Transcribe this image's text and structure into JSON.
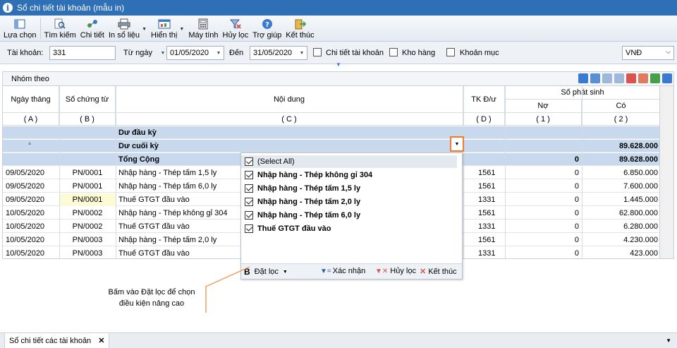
{
  "window": {
    "title": "Sổ chi tiết tài khoản (mẫu in)"
  },
  "toolbar": [
    {
      "label": "Lựa chọn",
      "icon": "select-icon"
    },
    {
      "label": "Tìm kiếm",
      "icon": "search-icon"
    },
    {
      "label": "Chi tiết",
      "icon": "detail-icon"
    },
    {
      "label": "In sổ liệu",
      "icon": "printer-icon",
      "dropdown": true
    },
    {
      "label": "Hiển thị",
      "icon": "display-icon",
      "dropdown": true
    },
    {
      "label": "Máy tính",
      "icon": "calculator-icon"
    },
    {
      "label": "Hủy lọc",
      "icon": "clear-filter-icon"
    },
    {
      "label": "Trợ giúp",
      "icon": "help-icon"
    },
    {
      "label": "Kết thúc",
      "icon": "exit-icon"
    }
  ],
  "filters": {
    "account_label": "Tài khoản:",
    "account_value": "331",
    "from_label": "Từ ngày",
    "from_value": "01/05/2020",
    "to_label": "Đến",
    "to_value": "31/05/2020",
    "detail_label": "Chi tiết tài khoản",
    "warehouse_label": "Kho hàng",
    "item_label": "Khoản mục",
    "currency": "VNĐ"
  },
  "group_bar": {
    "title": "Nhóm theo"
  },
  "grid": {
    "headers": {
      "date": "Ngày tháng",
      "doc": "Số chứng từ",
      "content": "Nội dung",
      "tk": "TK Đ/ư",
      "arising": "Số phát sinh",
      "debit": "Nợ",
      "credit": "Có"
    },
    "codes": {
      "date": "( A )",
      "doc": "( B )",
      "content": "( C )",
      "tk": "( D )",
      "debit": "( 1 )",
      "credit": "( 2 )"
    },
    "opening_label": "Dư đầu kỳ",
    "closing_label": "Dư cuối kỳ",
    "closing_credit": "89.628.000",
    "total_label": "Tổng Cộng",
    "total_debit": "0",
    "total_credit": "89.628.000",
    "rows": [
      {
        "date": "09/05/2020",
        "doc": "PN/0001",
        "content": "Nhập hàng - Thép tấm 1,5 ly",
        "tk": "1561",
        "debit": "0",
        "credit": "6.850.000"
      },
      {
        "date": "09/05/2020",
        "doc": "PN/0001",
        "content": "Nhập hàng - Thép tấm 6,0 ly",
        "tk": "1561",
        "debit": "0",
        "credit": "7.600.000"
      },
      {
        "date": "09/05/2020",
        "doc": "PN/0001",
        "content": "Thuế GTGT đầu vào",
        "tk": "1331",
        "debit": "0",
        "credit": "1.445.000"
      },
      {
        "date": "10/05/2020",
        "doc": "PN/0002",
        "content": "Nhập hàng - Thép không gỉ 304",
        "tk": "1561",
        "debit": "0",
        "credit": "62.800.000"
      },
      {
        "date": "10/05/2020",
        "doc": "PN/0002",
        "content": "Thuế GTGT đầu vào",
        "tk": "1331",
        "debit": "0",
        "credit": "6.280.000"
      },
      {
        "date": "10/05/2020",
        "doc": "PN/0003",
        "content": "Nhập hàng - Thép tấm 2,0 ly",
        "tk": "1561",
        "debit": "0",
        "credit": "4.230.000"
      },
      {
        "date": "10/05/2020",
        "doc": "PN/0003",
        "content": "Thuế GTGT đầu vào",
        "tk": "1331",
        "debit": "0",
        "credit": "423.000"
      }
    ]
  },
  "filter_popup": {
    "items": [
      {
        "label": "(Select All)",
        "checked": true
      },
      {
        "label": "Nhập hàng - Thép không gỉ 304",
        "checked": true
      },
      {
        "label": "Nhập hàng - Thép tấm 1,5 ly",
        "checked": true
      },
      {
        "label": "Nhập hàng - Thép tấm 2,0 ly",
        "checked": true
      },
      {
        "label": "Nhập hàng - Thép tấm 6,0 ly",
        "checked": true
      },
      {
        "label": "Thuế GTGT đầu vào",
        "checked": true
      }
    ],
    "set_filter": "Đặt lọc",
    "confirm": "Xác nhận",
    "cancel": "Hủy lọc",
    "close": "Kết thúc"
  },
  "callout": {
    "line1": "Bấm vào Đặt lọc để chọn",
    "line2": "điều kiện nâng cao"
  },
  "bottom_tab": {
    "label": "Sổ chi tiết các tài khoản"
  },
  "colors": {
    "titlebar": "#2f6fb5",
    "summary_row": "#c8d9ee",
    "highlight": "#f07b2a"
  }
}
